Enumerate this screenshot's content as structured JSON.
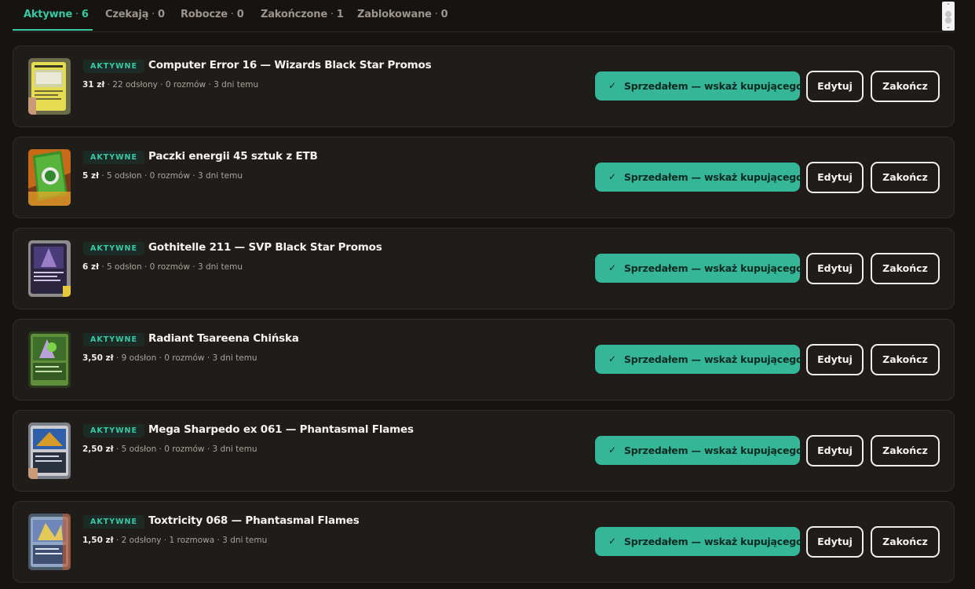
{
  "tabs": [
    {
      "label": "Aktywne",
      "count": "6",
      "active": true
    },
    {
      "label": "Czekają",
      "count": "0",
      "active": false
    },
    {
      "label": "Robocze",
      "count": "0",
      "active": false
    },
    {
      "label": "Zakończone",
      "count": "1",
      "active": false
    },
    {
      "label": "Zablokowane",
      "count": "0",
      "active": false
    }
  ],
  "separator": " · ",
  "actions": {
    "sold_label": "Sprzedałem — wskaż kupującego",
    "edit_label": "Edytuj",
    "end_label": "Zakończ"
  },
  "colors": {
    "accent": "#38c9a2",
    "sold_button": "#35b797",
    "background": "#161311",
    "card": "#1f1c1a"
  },
  "listings": [
    {
      "badge": "AKTYWNE",
      "title": "Computer Error 16 — Wizards Black Star Promos",
      "price": "31 zł",
      "stats": " · 22 odsłony · 0 rozmów · 3 dni temu",
      "thumb": "yellow-card"
    },
    {
      "badge": "AKTYWNE",
      "title": "Paczki energii 45 sztuk z ETB",
      "price": "5 zł",
      "stats": " · 5 odsłon · 0 rozmów · 3 dni temu",
      "thumb": "green-energy"
    },
    {
      "badge": "AKTYWNE",
      "title": "Gothitelle 211 — SVP Black Star Promos",
      "price": "6 zł",
      "stats": " · 5 odsłon · 0 rozmów · 3 dni temu",
      "thumb": "purple-card"
    },
    {
      "badge": "AKTYWNE",
      "title": "Radiant Tsareena Chińska",
      "price": "3,50 zł",
      "stats": " · 9 odsłon · 0 rozmów · 3 dni temu",
      "thumb": "green-card"
    },
    {
      "badge": "AKTYWNE",
      "title": "Mega Sharpedo ex 061 — Phantasmal Flames",
      "price": "2,50 zł",
      "stats": " · 5 odsłon · 0 rozmów · 3 dni temu",
      "thumb": "blue-card"
    },
    {
      "badge": "AKTYWNE",
      "title": "Toxtricity 068 — Phantasmal Flames",
      "price": "1,50 zł",
      "stats": " · 2 odsłony · 1 rozmowa · 3 dni temu",
      "thumb": "holo-card"
    }
  ]
}
